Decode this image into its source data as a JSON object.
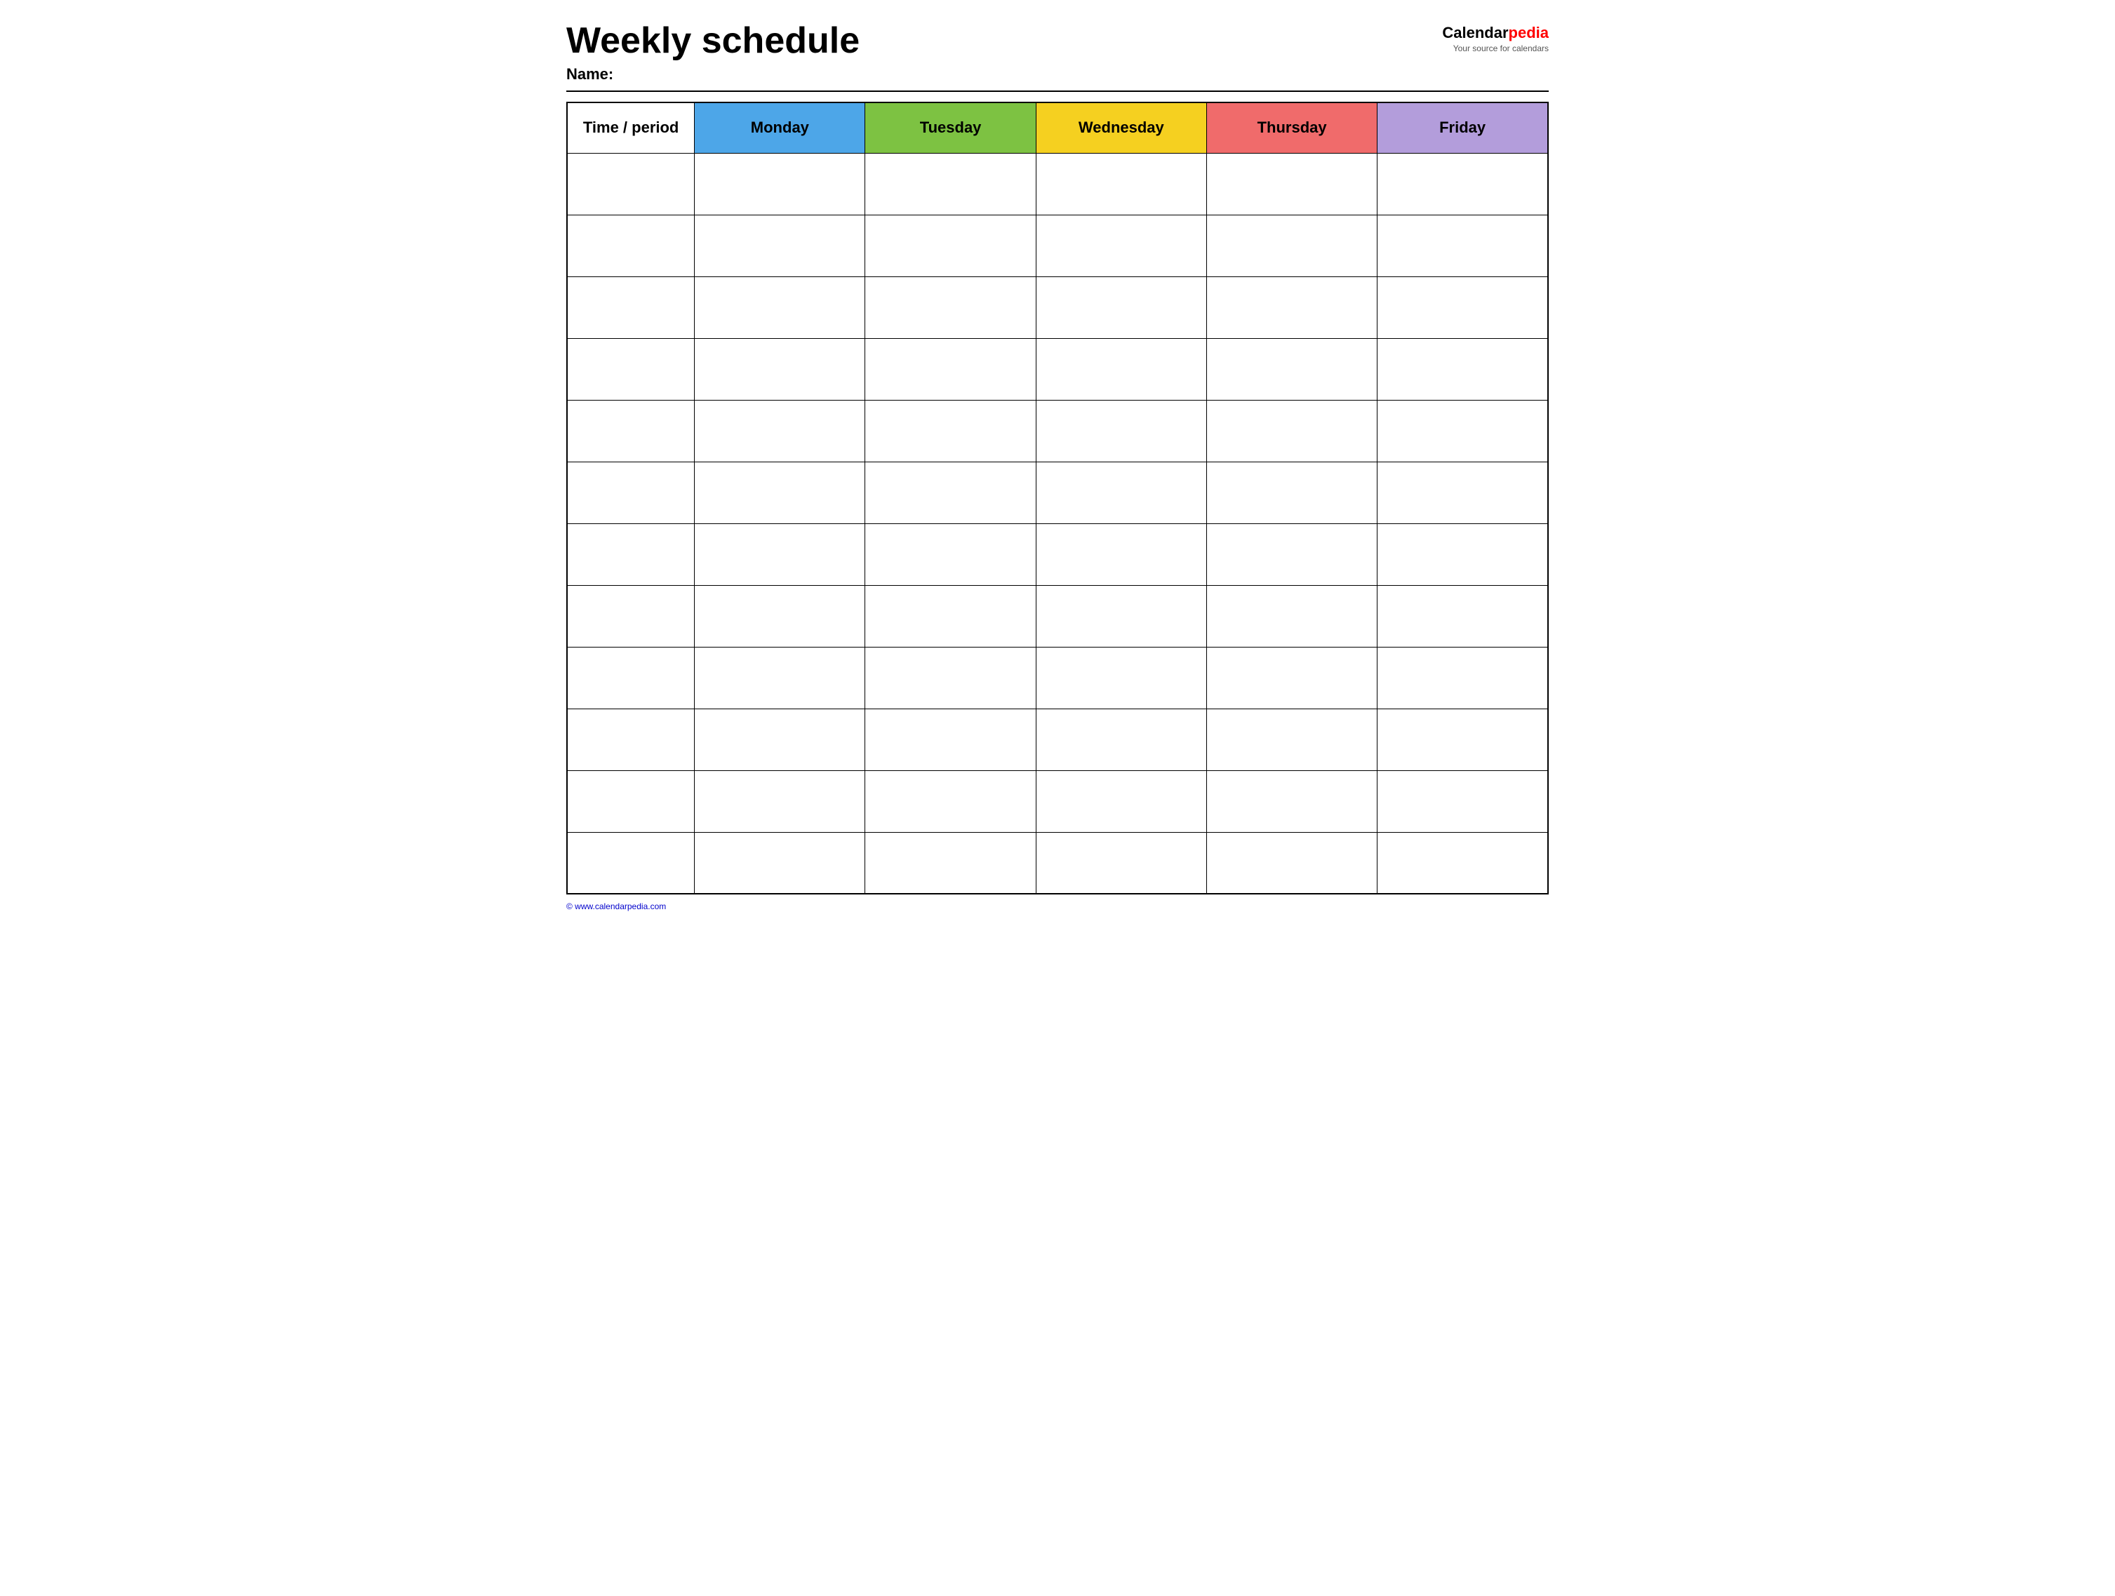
{
  "header": {
    "title": "Weekly schedule",
    "name_label": "Name:",
    "logo": {
      "calendar_text": "Calendar",
      "pedia_text": "pedia",
      "tagline": "Your source for calendars"
    }
  },
  "table": {
    "columns": [
      {
        "id": "time",
        "label": "Time / period",
        "color": "#ffffff"
      },
      {
        "id": "monday",
        "label": "Monday",
        "color": "#4da6e8"
      },
      {
        "id": "tuesday",
        "label": "Tuesday",
        "color": "#7dc242"
      },
      {
        "id": "wednesday",
        "label": "Wednesday",
        "color": "#f5d020"
      },
      {
        "id": "thursday",
        "label": "Thursday",
        "color": "#f06b6b"
      },
      {
        "id": "friday",
        "label": "Friday",
        "color": "#b39ddb"
      }
    ],
    "row_count": 12
  },
  "footer": {
    "copyright": "© www.calendarpedia.com"
  }
}
